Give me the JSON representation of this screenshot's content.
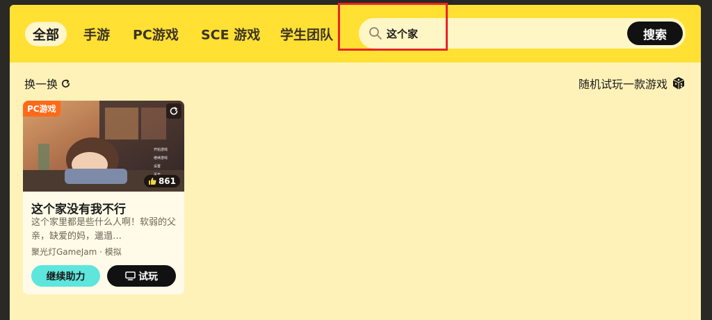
{
  "tabs": [
    {
      "label": "全部",
      "active": true
    },
    {
      "label": "手游",
      "active": false
    },
    {
      "label": "PC游戏",
      "active": false
    },
    {
      "label": "SCE 游戏",
      "active": false
    },
    {
      "label": "学生团队",
      "active": false
    }
  ],
  "search": {
    "value": "这个家",
    "button_label": "搜索"
  },
  "toolbar": {
    "swap_label": "换一换",
    "random_label": "随机试玩一款游戏"
  },
  "game_card": {
    "tag": "PC游戏",
    "likes": "861",
    "title": "这个家没有我不行",
    "description": "这个家里都是些什么人啊！软弱的父亲，缺爱的妈，邋遢…",
    "meta": "聚光灯GameJam · 模拟",
    "boost_label": "继续助力",
    "play_label": "试玩"
  },
  "colors": {
    "topbar": "#ffe033",
    "background": "#fff2b9",
    "accent_teal": "#5ee5dc",
    "tag_orange": "#ff6a1a",
    "highlight_red": "#e8232a"
  },
  "icons": [
    "search-icon",
    "refresh-icon",
    "dice-icon",
    "share-icon",
    "thumb-up-icon",
    "monitor-icon"
  ]
}
